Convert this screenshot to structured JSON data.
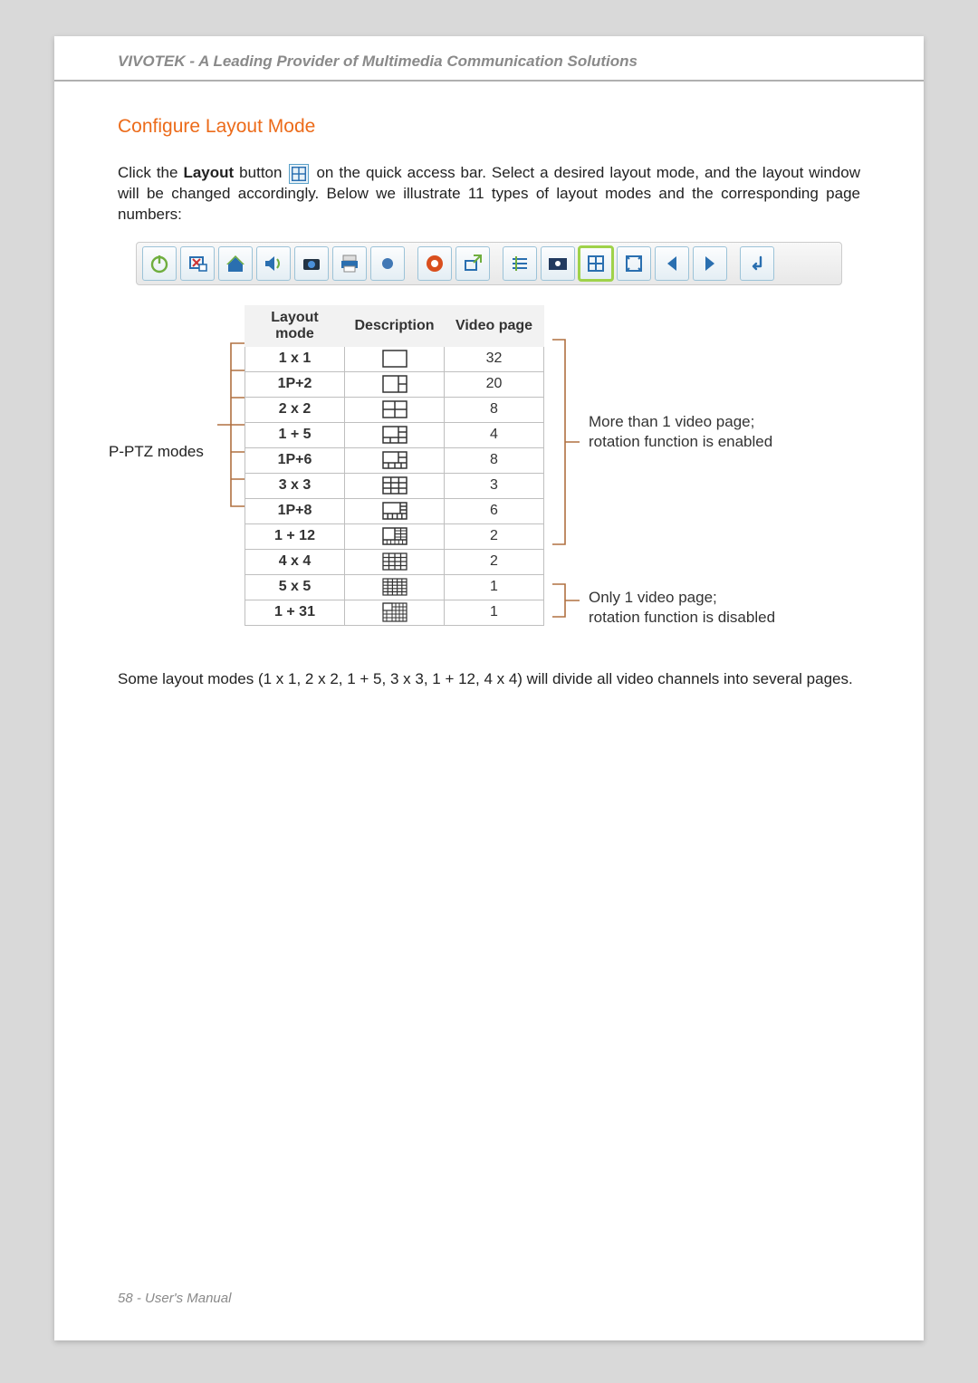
{
  "header": {
    "title": "VIVOTEK - A Leading Provider of Multimedia Communication Solutions"
  },
  "section": {
    "heading": "Configure Layout Mode"
  },
  "intro": {
    "pre": "Click the ",
    "bold": "Layout",
    "post": " button ",
    "tail": " on the quick access bar. Select a desired layout mode, and the layout window will be changed accordingly. Below we illustrate 11 types of layout modes and the corresponding page numbers:"
  },
  "closing": "Some layout modes (1 x 1, 2 x 2, 1 + 5, 3 x 3, 1 + 12, 4 x 4) will divide all video channels into several pages.",
  "table": {
    "headers": {
      "mode": "Layout mode",
      "desc": "Description",
      "page": "Video page"
    },
    "rows": [
      {
        "mode": "1 x 1",
        "page": "32"
      },
      {
        "mode": "1P+2",
        "page": "20"
      },
      {
        "mode": "2 x 2",
        "page": "8"
      },
      {
        "mode": "1 + 5",
        "page": "4"
      },
      {
        "mode": "1P+6",
        "page": "8"
      },
      {
        "mode": "3 x 3",
        "page": "3"
      },
      {
        "mode": "1P+8",
        "page": "6"
      },
      {
        "mode": "1 + 12",
        "page": "2"
      },
      {
        "mode": "4 x 4",
        "page": "2"
      },
      {
        "mode": "5 x 5",
        "page": "1"
      },
      {
        "mode": "1 + 31",
        "page": "1"
      }
    ]
  },
  "annotations": {
    "left_label": "P-PTZ modes",
    "note_more_l1": "More than 1 video page;",
    "note_more_l2": "rotation function is enabled",
    "note_one_l1": "Only 1 video page;",
    "note_one_l2": "rotation function is disabled"
  },
  "footer": {
    "page_no": "58",
    "sep": " - ",
    "manual": "User's Manual"
  },
  "toolbar_icons": [
    "power-icon",
    "remove-icon",
    "home-icon",
    "volume-icon",
    "camera-icon",
    "print-icon",
    "record-icon",
    "browser-icon",
    "export-icon",
    "list-icon",
    "snapshot-icon",
    "layout-icon",
    "fullscreen-icon",
    "back-icon",
    "forward-icon",
    "return-icon"
  ]
}
